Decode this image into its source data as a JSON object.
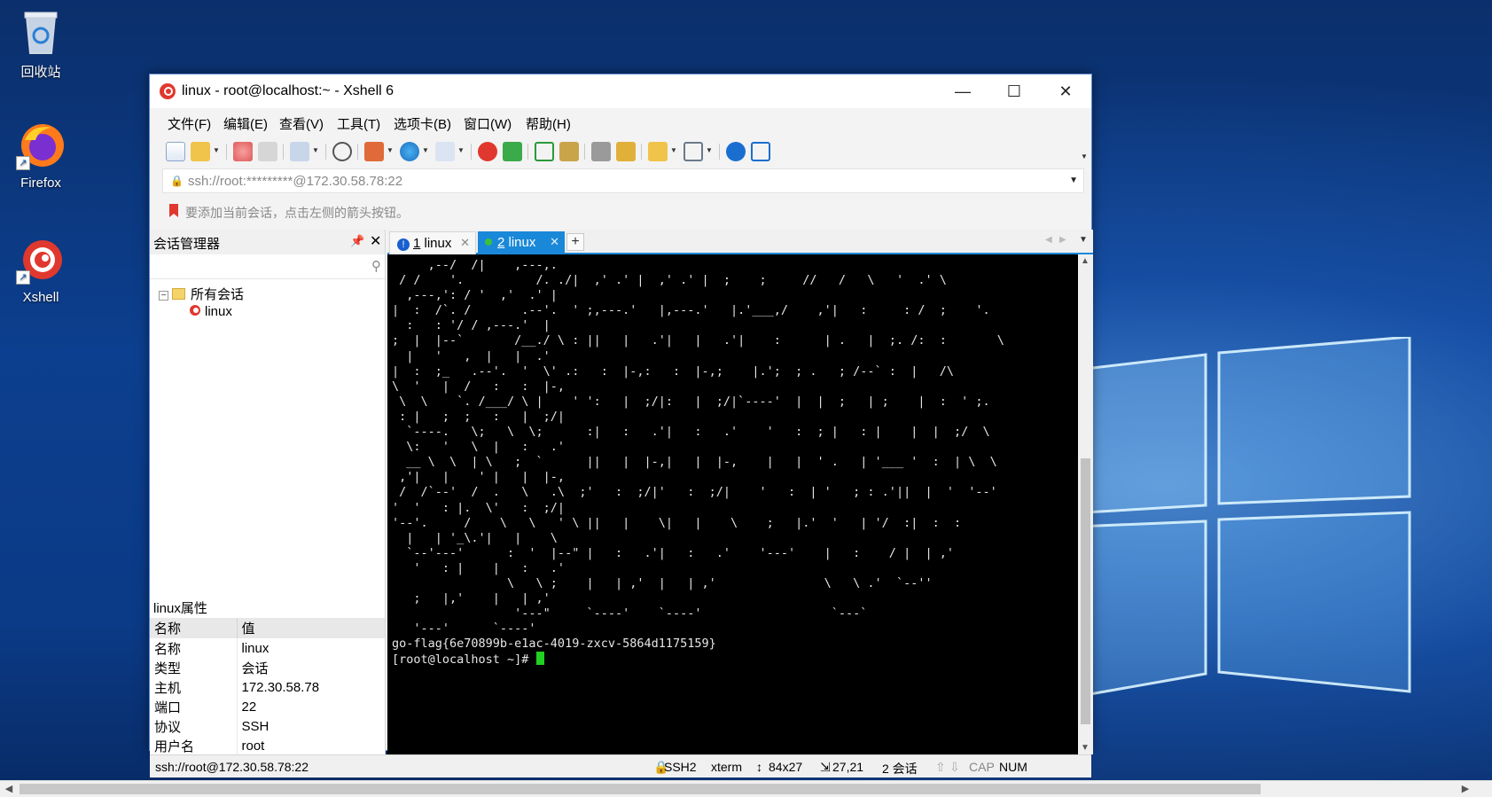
{
  "desktop": {
    "icons": [
      {
        "label": "回收站",
        "icon": "recycle-bin-icon"
      },
      {
        "label": "Firefox",
        "icon": "firefox-icon"
      },
      {
        "label": "Xshell",
        "icon": "xshell-icon"
      }
    ]
  },
  "window": {
    "title": "linux - root@localhost:~ - Xshell 6",
    "minimize": "—",
    "maximize": "☐",
    "close": "✕"
  },
  "menu": [
    "文件(F)",
    "编辑(E)",
    "查看(V)",
    "工具(T)",
    "选项卡(B)",
    "窗口(W)",
    "帮助(H)"
  ],
  "address": {
    "value": "ssh://root:*********@172.30.58.78:22"
  },
  "hint": "要添加当前会话，点击左侧的箭头按钮。",
  "session_manager": {
    "title": "会话管理器",
    "root_folder": "所有会话",
    "sessions": [
      "linux"
    ]
  },
  "properties": {
    "title": "linux属性",
    "header": [
      "名称",
      "值"
    ],
    "rows": [
      [
        "名称",
        "linux"
      ],
      [
        "类型",
        "会话"
      ],
      [
        "主机",
        "172.30.58.78"
      ],
      [
        "端口",
        "22"
      ],
      [
        "协议",
        "SSH"
      ],
      [
        "用户名",
        "root"
      ]
    ]
  },
  "tabs": [
    {
      "num": "1",
      "label": "linux",
      "state": "warning"
    },
    {
      "num": "2",
      "label": "linux",
      "state": "active"
    }
  ],
  "terminal": {
    "art": "     ,--/  /|    ,---,.\n / /    '.          /. ./|  ,' .' |  ,' .' |  ;    ;     //   /   \\   '  .' \\\n  ,---,': / '  ,'  .' |\n|  :  /`. /       .--'.  ' ;,---.'   |,---.'   |.'___,/    ,'|   :     : /  ;    '.\n  :   : '/ / ,---.'  |\n;  |  |--`       /__./ \\ : ||   |   .'|   |   .'|    :      | .   |  ;. /:  :       \\\n  |   '   ,  |   |  .'\n|  :  ;_   .--'.  '  \\' .:   :  |-,:   :  |-,;    |.';  ; .   ; /--` :  |   /\\\n\\  '   |  /   :   :  |-,\n \\  \\    `. /___/ \\ |    ' ':   |  ;/|:   |  ;/|`----'  |  |  ;   | ;    |  :  ' ;.\n : |   ;  ;   :   |  ;/|\n  `----.   \\;   \\  \\;      :|   :   .'|   :   .'    '   :  ; |   : |    |  |  ;/  \\\n  \\:   '   \\  |   :   .'\n  __ \\  \\  | \\   ;  `      ||   |  |-,|   |  |-,    |   |  ' .   | '___ '  :  | \\  \\\n ,'|   |    ' |   |  |-,\n /  /`--'  /  .   \\   .\\  ;'   :  ;/|'   :  ;/|    '   :  | '   ; : .'||  |  '  '--'\n'  '   : |.  \\'   :  ;/|\n'--'.     /    \\   \\   ' \\ ||   |    \\|   |    \\    ;   |.'  '   | '/  :|  :  :\n  |   | '_\\.'|   |    \\\n  `--'---'      :  '  |--\" |   :   .'|   :   .'    '---'    |   :    / |  | ,'\n   '   : |    |   :   .'\n                \\   \\ ;    |   | ,'  |   | ,'               \\   \\ .'  `--''\n   ;   |,'    |   | ,'\n                 '---\"     `----'    `----'                  `---`\n   '---'      `----'",
    "flag_line": "go-flag{6e70899b-e1ac-4019-zxcv-5864d1175159}",
    "prompt": "[root@localhost ~]# "
  },
  "statusbar": {
    "connection": "ssh://root@172.30.58.78:22",
    "protocol": "SSH2",
    "term": "xterm",
    "size": "84x27",
    "cursor": "27,21",
    "sessions": "2 会话",
    "caps": "CAP",
    "num": "NUM"
  },
  "colors": {
    "accent": "#1a88d8",
    "terminal_bg": "#000000",
    "cursor": "#22d022"
  }
}
